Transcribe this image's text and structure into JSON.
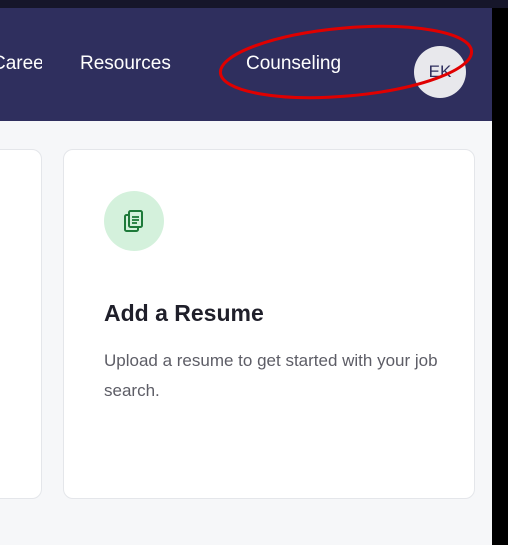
{
  "nav": {
    "partial_item": "Careers",
    "resources": "Resources",
    "counseling": "Counseling",
    "avatar_initials": "EK"
  },
  "card": {
    "title": "Add a Resume",
    "description": "Upload a resume to get started with your job search.",
    "icon": "document-icon"
  },
  "colors": {
    "navbar": "#2f2f5e",
    "icon_bg": "#d4f1dc",
    "icon_fg": "#1e7a3a",
    "highlight": "#e00000"
  }
}
